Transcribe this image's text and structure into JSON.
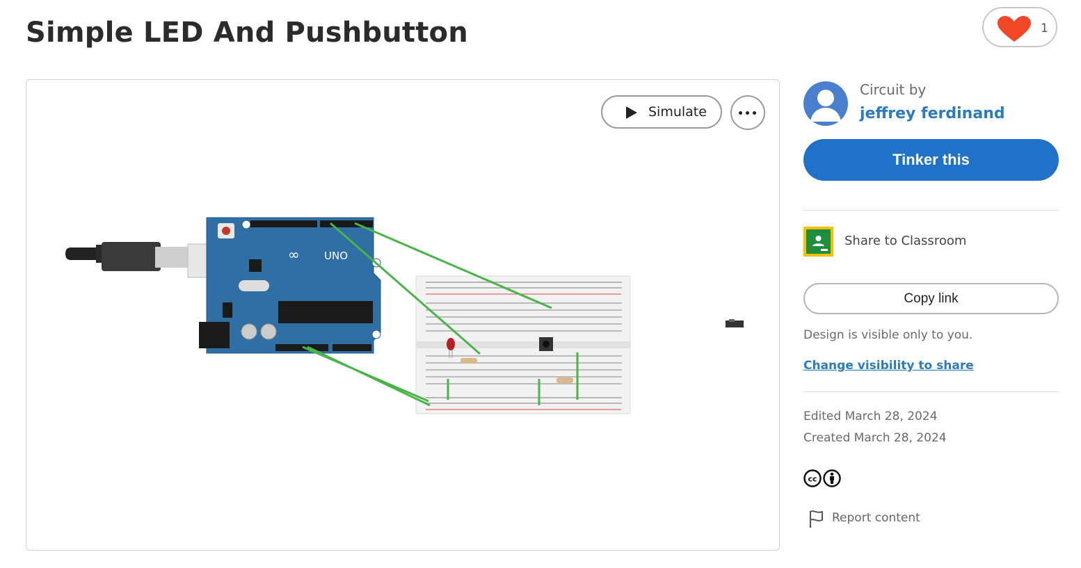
{
  "page": {
    "title": "Simple LED And Pushbutton"
  },
  "like": {
    "count": "1",
    "icon": "heart-icon",
    "color": "#f24726"
  },
  "viewer": {
    "simulate_label": "Simulate",
    "more_icon": "ellipsis-icon"
  },
  "sidebar": {
    "circuit_by": "Circuit by",
    "author": "jeffrey ferdinand",
    "tinker_label": "Tinker this",
    "share_classroom": "Share to Classroom",
    "copy_link": "Copy link",
    "visibility_note": "Design is visible only to you.",
    "change_visibility": "Change visibility to share",
    "edited": "Edited March 28, 2024",
    "created": "Created March 28, 2024",
    "license_icons": [
      "cc-icon",
      "attribution-icon"
    ],
    "report": "Report content"
  },
  "colors": {
    "accent": "#1f72c8",
    "link": "#2b7bc1",
    "arduino": "#2f6fa3",
    "wire": "#49b549"
  }
}
